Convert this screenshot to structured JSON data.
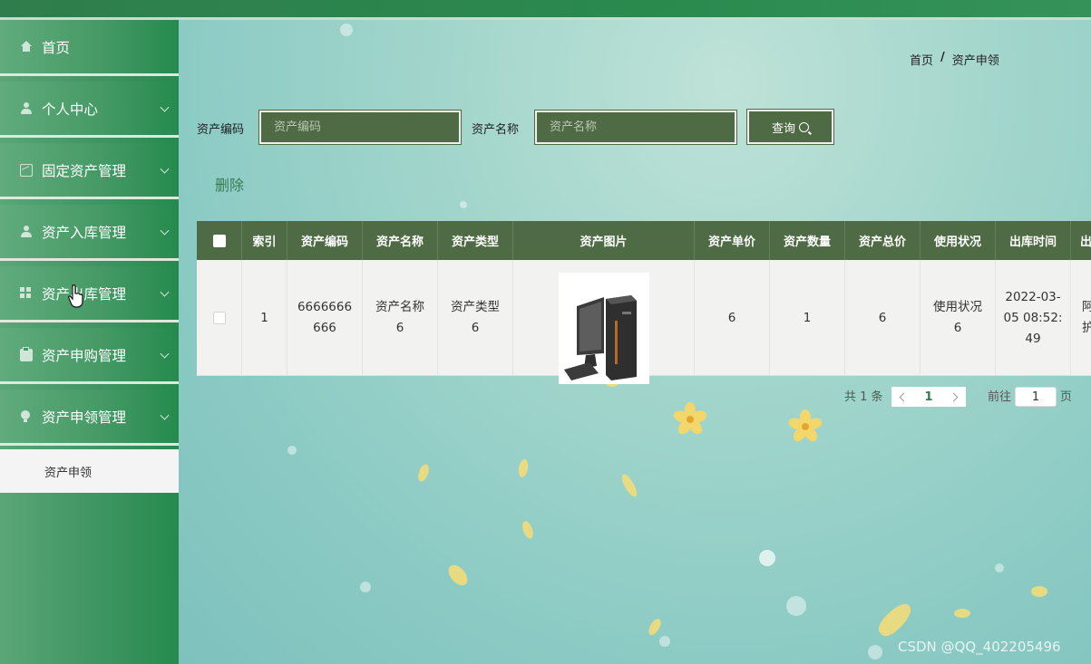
{
  "sidebar": {
    "items": [
      {
        "label": "首页",
        "icon": "home-icon"
      },
      {
        "label": "个人中心",
        "icon": "user-icon"
      },
      {
        "label": "固定资产管理",
        "icon": "chart-icon"
      },
      {
        "label": "资产入库管理",
        "icon": "user-icon"
      },
      {
        "label": "资产出库管理",
        "icon": "grid-icon"
      },
      {
        "label": "资产申购管理",
        "icon": "clipboard-icon"
      },
      {
        "label": "资产申领管理",
        "icon": "bulb-icon"
      }
    ],
    "sub_item": "资产申领"
  },
  "breadcrumb": {
    "home": "首页",
    "separator": "/",
    "current": "资产申领"
  },
  "search": {
    "code_label": "资产编码",
    "code_placeholder": "资产编码",
    "name_label": "资产名称",
    "name_placeholder": "资产名称",
    "query_label": "查询"
  },
  "toolbar": {
    "delete_label": "删除"
  },
  "table": {
    "headers": [
      "索引",
      "资产编码",
      "资产名称",
      "资产类型",
      "资产图片",
      "资产单价",
      "资产数量",
      "资产总价",
      "使用状况",
      "出库时间",
      "出"
    ],
    "rows": [
      {
        "index": "1",
        "code": "6666666\n666",
        "name": "资产名称\n6",
        "type": "资产类型\n6",
        "price": "6",
        "quantity": "1",
        "total": "6",
        "status": "使用状况\n6",
        "out_time": "2022-03-\n05 08:52:\n49",
        "extra": "阿\n护"
      }
    ]
  },
  "pagination": {
    "total_text": "共 1 条",
    "current_page": "1",
    "goto_label": "前往",
    "goto_value": "1",
    "page_suffix": "页"
  },
  "watermark": "CSDN @QQ_402205496",
  "colors": {
    "sidebar": "#3f9562",
    "header_bg": "#4f6b45",
    "accent": "#3a7b55"
  }
}
